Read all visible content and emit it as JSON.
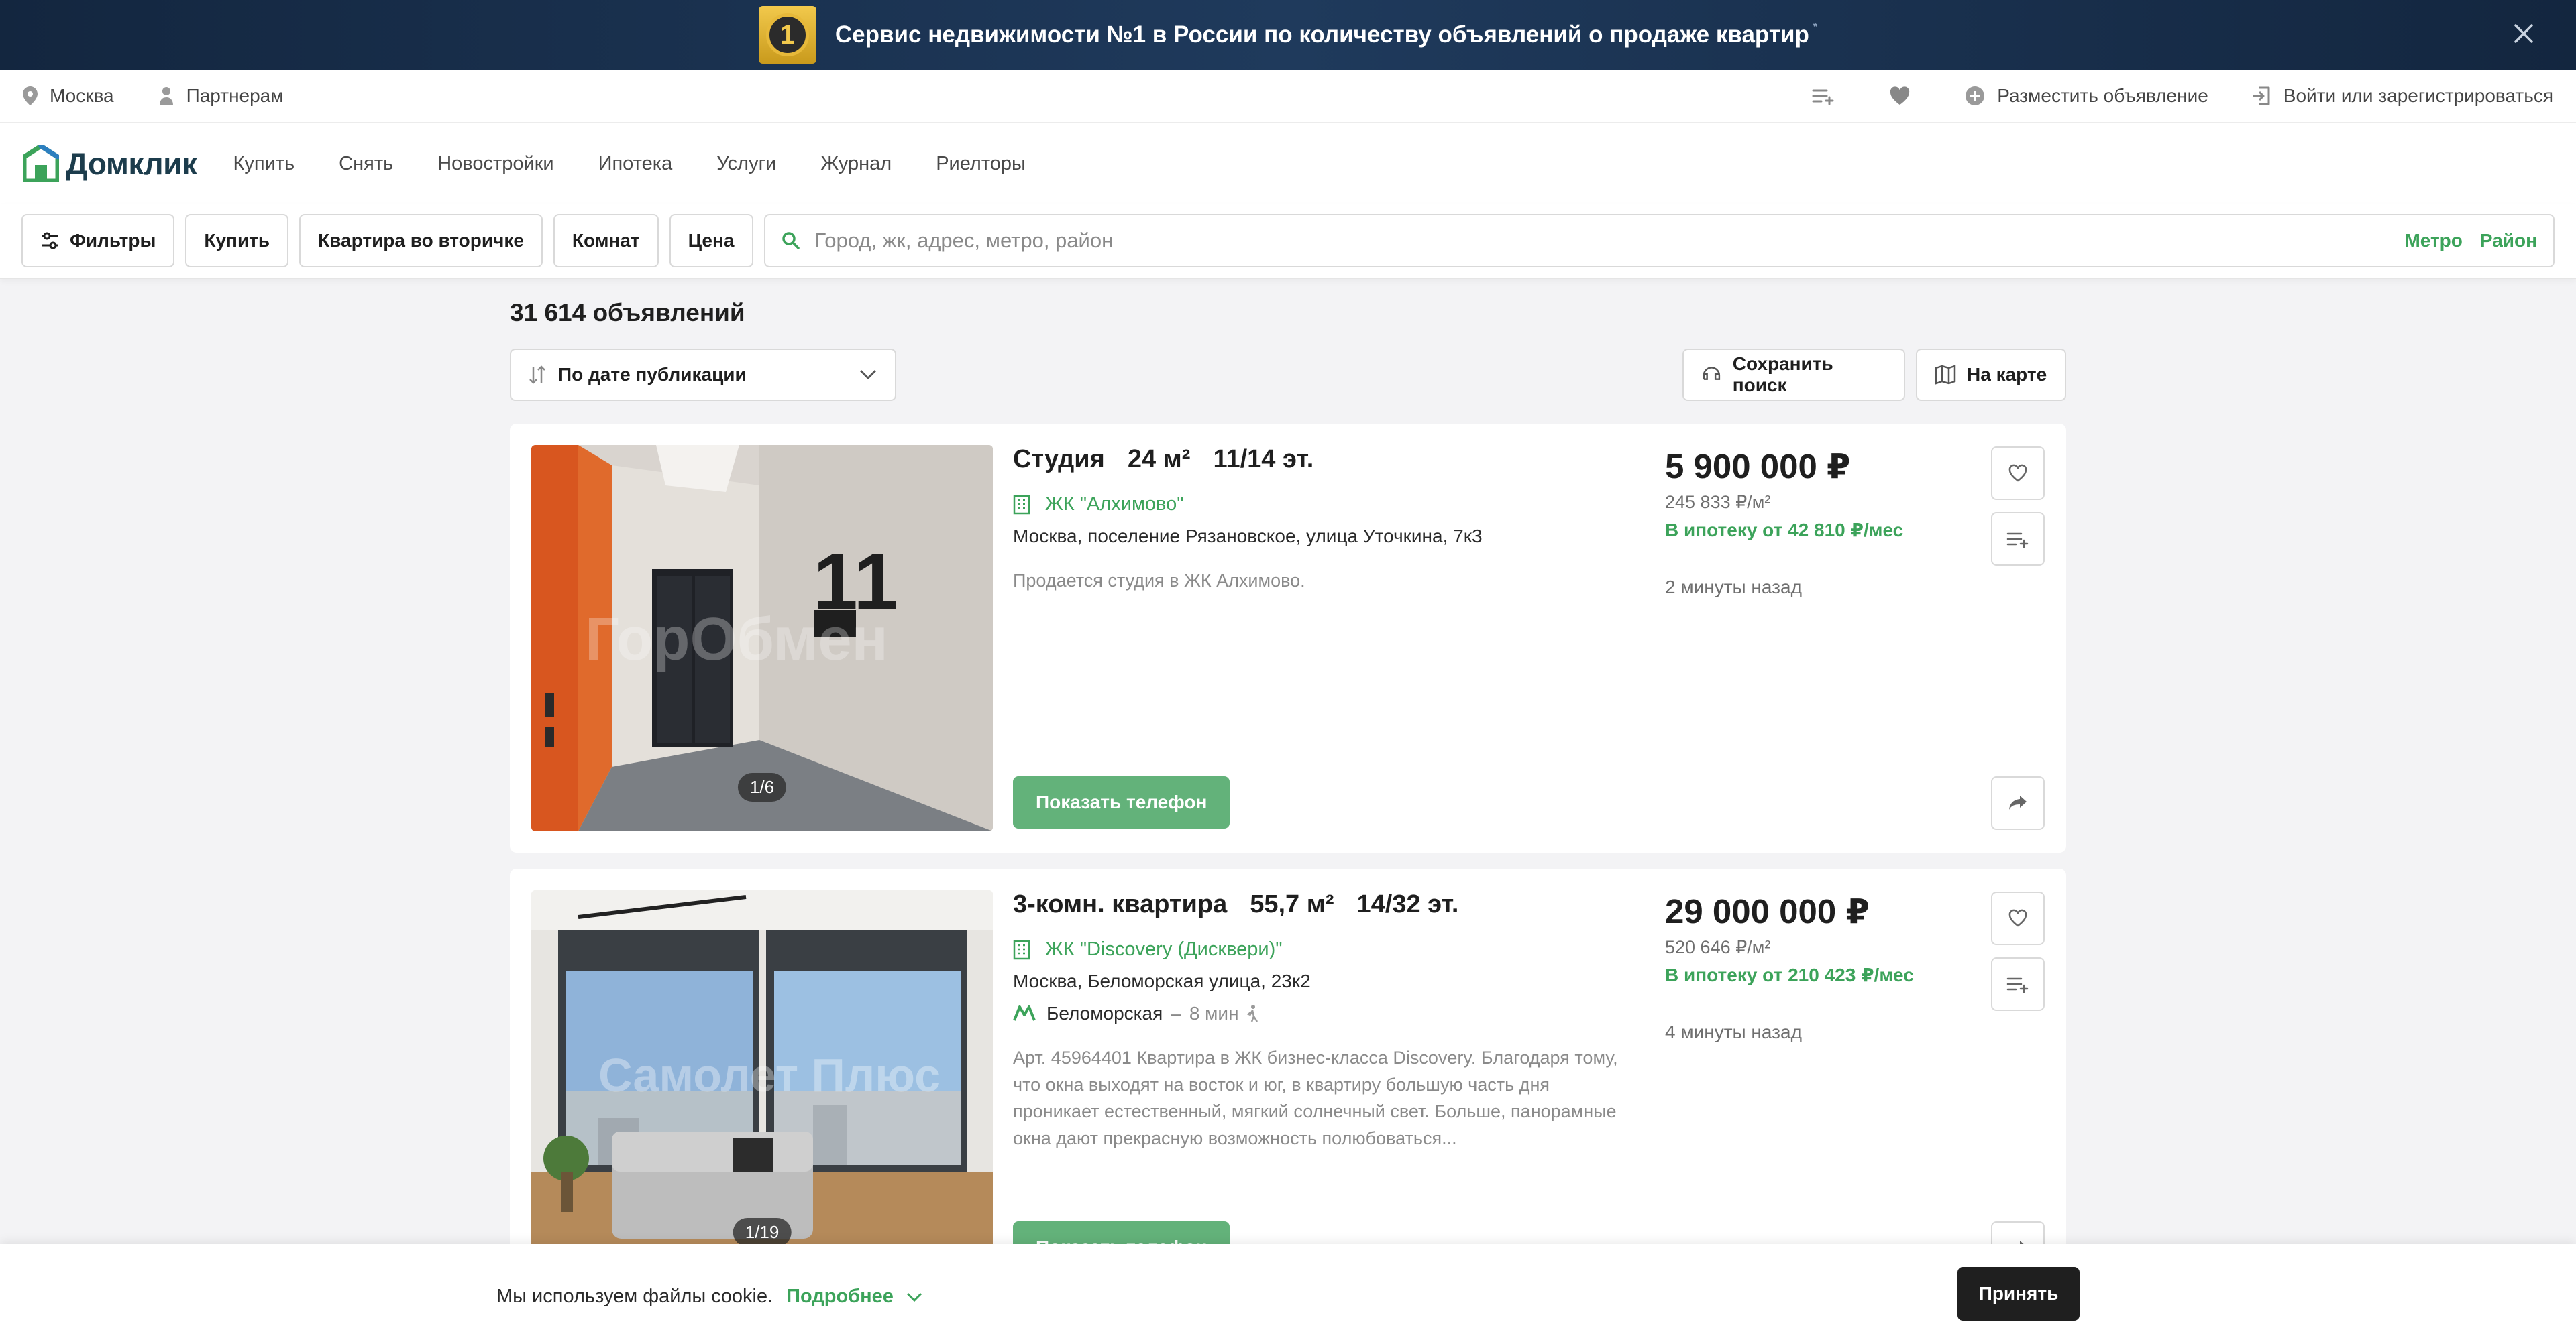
{
  "promo": {
    "badge": "1",
    "text": "Сервис недвижимости №1 в России по количеству объявлений о продаже квартир",
    "footnote": "*"
  },
  "util": {
    "city": "Москва",
    "partners": "Партнерам",
    "post_ad": "Разместить объявление",
    "login": "Войти или зарегистрироваться"
  },
  "nav": {
    "logo": "Домклик",
    "links": [
      "Купить",
      "Снять",
      "Новостройки",
      "Ипотека",
      "Услуги",
      "Журнал",
      "Риелторы"
    ]
  },
  "filters": {
    "filters_btn": "Фильтры",
    "deal": "Купить",
    "type": "Квартира во вторичке",
    "rooms": "Комнат",
    "price": "Цена",
    "search_placeholder": "Город, жк, адрес, метро, район",
    "metro_link": "Метро",
    "district_link": "Район"
  },
  "results": {
    "count": "31 614 объявлений",
    "sort": "По дате публикации",
    "save_search": "Сохранить поиск",
    "on_map": "На карте"
  },
  "listings": [
    {
      "type": "Студия",
      "area": "24 м²",
      "floor": "11/14 эт.",
      "complex": "ЖК \"Алхимово\"",
      "address": "Москва, поселение Рязановское, улица Уточкина, 7к3",
      "description": "Продается студия в ЖК Алхимово.",
      "price": "5 900 000 ₽",
      "price_per_m2": "245 833 ₽/м²",
      "mortgage": "В ипотеку от 42 810 ₽/мес",
      "posted": "2 минуты назад",
      "photo_counter": "1/6",
      "watermark": "ГорОбмен",
      "phone_btn": "Показать телефон"
    },
    {
      "type": "3-комн. квартира",
      "area": "55,7 м²",
      "floor": "14/32 эт.",
      "complex": "ЖК \"Discovery (Дисквери)\"",
      "address": "Москва, Беломорская улица, 23к2",
      "metro": "Беломорская",
      "metro_dist": "8 мин",
      "description": "Арт. 45964401 Квартира в ЖК бизнес-класса Discovery. Благодаря тому, что окна выходят на восток и юг, в квартиру большую часть дня проникает естественный, мягкий солнечный свет. Больше, панорамные окна дают прекрасную возможность полюбоваться...",
      "price": "29 000 000 ₽",
      "price_per_m2": "520 646 ₽/м²",
      "mortgage": "В ипотеку от 210 423 ₽/мес",
      "posted": "4 минуты назад",
      "photo_counter": "1/19",
      "watermark": "Самолет Плюс",
      "phone_btn": "Показать телефон"
    }
  ],
  "cookie": {
    "text": "Мы используем файлы cookie.",
    "more": "Подробнее",
    "accept": "Принять"
  },
  "colors": {
    "accent": "#3ca35a",
    "button_green": "#63b27a",
    "banner_bg": "#1f3a5c",
    "dark_button": "#1f1f1f"
  }
}
